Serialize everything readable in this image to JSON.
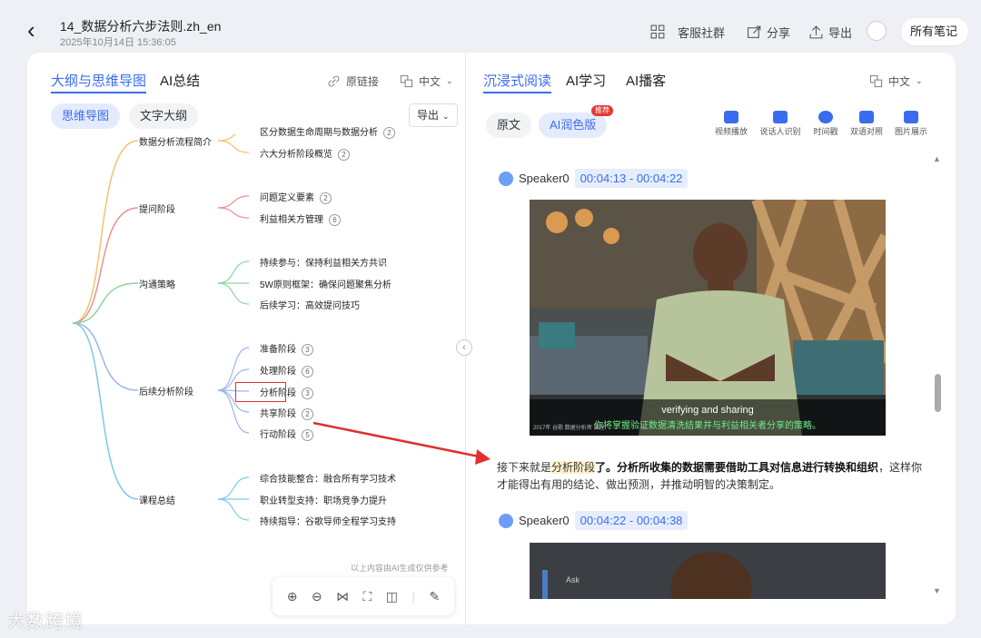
{
  "header": {
    "title": "14_数据分析六步法则.zh_en",
    "date": "2025年10月14日 15:36:05",
    "service_group": "客服社群",
    "share": "分享",
    "export": "导出",
    "all_notes": "所有笔记"
  },
  "left": {
    "tabs": [
      "大纲与思维导图",
      "AI总结"
    ],
    "original_link": "原链接",
    "language": "中文",
    "view_modes": [
      "思维导图",
      "文字大纲"
    ],
    "export_label": "导出",
    "mindmap": {
      "branches": [
        {
          "label": "数据分析流程简介",
          "color": "#f2c36b",
          "children": [
            {
              "label": "区分数据生命周期与数据分析",
              "badge": "2"
            },
            {
              "label": "六大分析阶段概览",
              "badge": "2"
            }
          ]
        },
        {
          "label": "提问阶段",
          "color": "#ee8f8f",
          "children": [
            {
              "label": "问题定义要素",
              "badge": "2"
            },
            {
              "label": "利益相关方管理",
              "badge": "6"
            }
          ]
        },
        {
          "label": "沟通策略",
          "color": "#8fd49d",
          "children": [
            {
              "label": "持续参与：保持利益相关方共识",
              "badge": ""
            },
            {
              "label": "5W原则框架：确保问题聚焦分析",
              "badge": ""
            },
            {
              "label": "后续学习：高效提问技巧",
              "badge": ""
            }
          ]
        },
        {
          "label": "后续分析阶段",
          "color": "#9ab5ec",
          "children": [
            {
              "label": "准备阶段",
              "badge": "3"
            },
            {
              "label": "处理阶段",
              "badge": "6"
            },
            {
              "label": "分析阶段",
              "badge": "3"
            },
            {
              "label": "共享阶段",
              "badge": "2"
            },
            {
              "label": "行动阶段",
              "badge": "5"
            }
          ]
        },
        {
          "label": "课程总结",
          "color": "#7fc7ea",
          "children": [
            {
              "label": "综合技能整合：融合所有学习技术",
              "badge": ""
            },
            {
              "label": "职业转型支持：职场竞争力提升",
              "badge": ""
            },
            {
              "label": "持续指导：谷歌导师全程学习支持",
              "badge": ""
            }
          ]
        }
      ]
    },
    "disclaimer": "以上内容由AI生成仅供参考"
  },
  "right": {
    "tabs": [
      "沉浸式阅读",
      "AI学习",
      "AI播客"
    ],
    "language": "中文",
    "versions": [
      "原文",
      "AI润色版"
    ],
    "recommend_badge": "推荐",
    "tools": [
      "视频播放",
      "说话人识别",
      "时间戳",
      "双语对照",
      "图片展示"
    ],
    "segments": [
      {
        "speaker": "Speaker0",
        "time": "00:04:13 - 00:04:22",
        "subtitle_en": "verifying and sharing",
        "subtitle_zh": "你将掌握验证数据清洗结果并与利益相关者分享的策略。",
        "subtitle_src": "2017年 谷歌 数据分析师 课程"
      },
      {
        "speaker": "Speaker0",
        "time": "00:04:22 - 00:04:38",
        "video_text": "Ask"
      }
    ],
    "paragraph": {
      "pre": "接下来就是",
      "highlight": "分析阶段",
      "bold": "了。分析所收集的数据需要借助工具对信息进行转换和组织",
      "post": "，这样你才能得出有用的结论、做出预测，并推动明智的决策制定。"
    }
  },
  "watermark": "大数跨境"
}
